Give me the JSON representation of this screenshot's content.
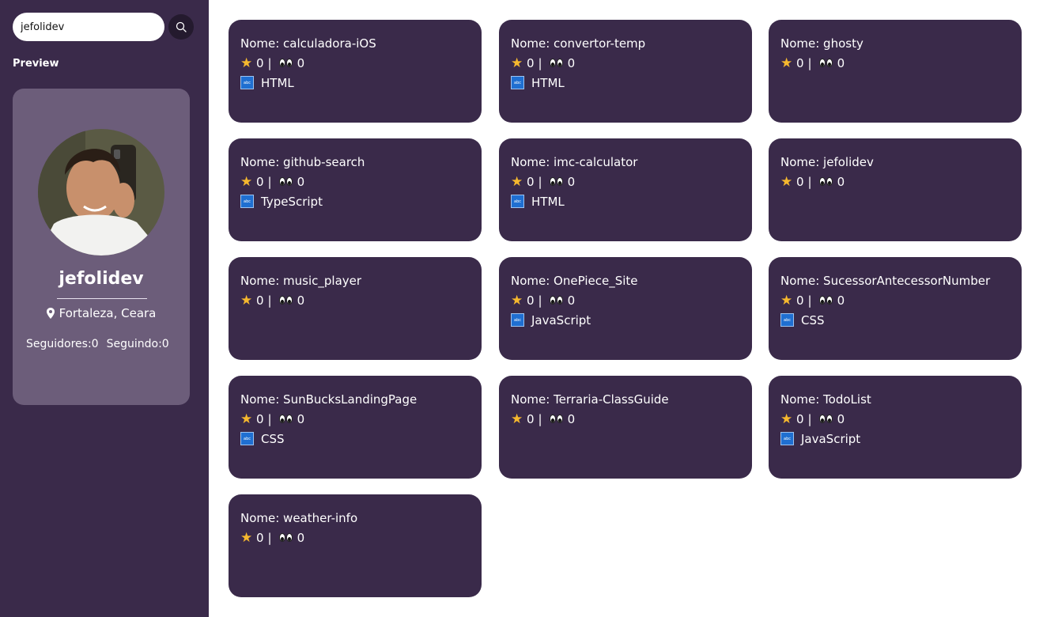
{
  "search": {
    "value": "jefolidev"
  },
  "sidebar": {
    "preview_label": "Preview"
  },
  "profile": {
    "username": "jefolidev",
    "location": "Fortaleza, Ceara",
    "followers": "Seguidores:0",
    "following": "Seguindo:0"
  },
  "repos": [
    {
      "name": "Nome: calculadora-iOS",
      "stars": "0",
      "watchers": "0",
      "language": "HTML"
    },
    {
      "name": "Nome: convertor-temp",
      "stars": "0",
      "watchers": "0",
      "language": "HTML"
    },
    {
      "name": "Nome: ghosty",
      "stars": "0",
      "watchers": "0",
      "language": ""
    },
    {
      "name": "Nome: github-search",
      "stars": "0",
      "watchers": "0",
      "language": "TypeScript"
    },
    {
      "name": "Nome: imc-calculator",
      "stars": "0",
      "watchers": "0",
      "language": "HTML"
    },
    {
      "name": "Nome: jefolidev",
      "stars": "0",
      "watchers": "0",
      "language": ""
    },
    {
      "name": "Nome: music_player",
      "stars": "0",
      "watchers": "0",
      "language": ""
    },
    {
      "name": "Nome: OnePiece_Site",
      "stars": "0",
      "watchers": "0",
      "language": "JavaScript"
    },
    {
      "name": "Nome: SucessorAntecessorNumber",
      "stars": "0",
      "watchers": "0",
      "language": "CSS"
    },
    {
      "name": "Nome: SunBucksLandingPage",
      "stars": "0",
      "watchers": "0",
      "language": "CSS"
    },
    {
      "name": "Nome: Terraria-ClassGuide",
      "stars": "0",
      "watchers": "0",
      "language": ""
    },
    {
      "name": "Nome: TodoList",
      "stars": "0",
      "watchers": "0",
      "language": "JavaScript"
    },
    {
      "name": "Nome: weather-info",
      "stars": "0",
      "watchers": "0",
      "language": ""
    }
  ],
  "colors": {
    "sidebar_bg": "#3a2a4a",
    "card_bg": "#3a2a4a",
    "profile_card_bg": "#6c5d7a",
    "star": "#f5b82e",
    "language_icon": "#1f6fd1"
  },
  "icons": [
    "search-icon",
    "location-pin-icon",
    "star-icon",
    "eyes-icon",
    "language-icon"
  ]
}
